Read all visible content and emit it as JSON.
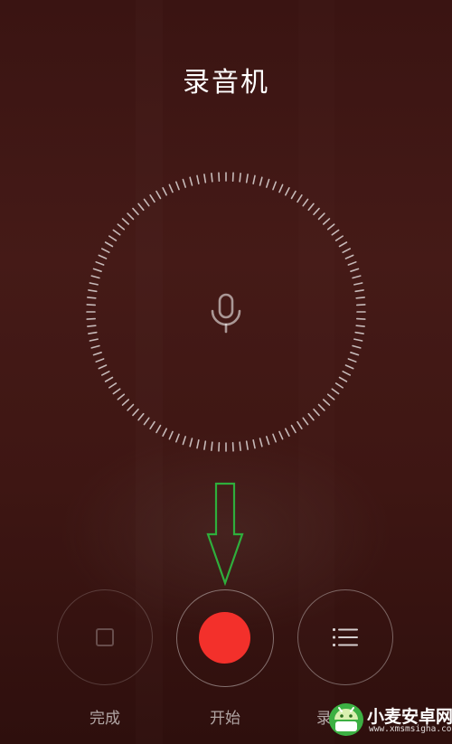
{
  "app": {
    "title": "录音机"
  },
  "controls": {
    "done_label": "完成",
    "start_label": "开始",
    "list_label": "录音"
  },
  "icons": {
    "mic": "microphone-icon",
    "done": "square-stop-icon",
    "record": "record-dot-icon",
    "list": "list-icon",
    "pointer": "down-arrow-annotation"
  },
  "colors": {
    "record_red": "#f3302b",
    "annotation_green": "#2fae3c",
    "background": "#3a1412"
  },
  "watermark": {
    "name": "小麦安卓网",
    "url": "www.xmsmsigha.com"
  }
}
